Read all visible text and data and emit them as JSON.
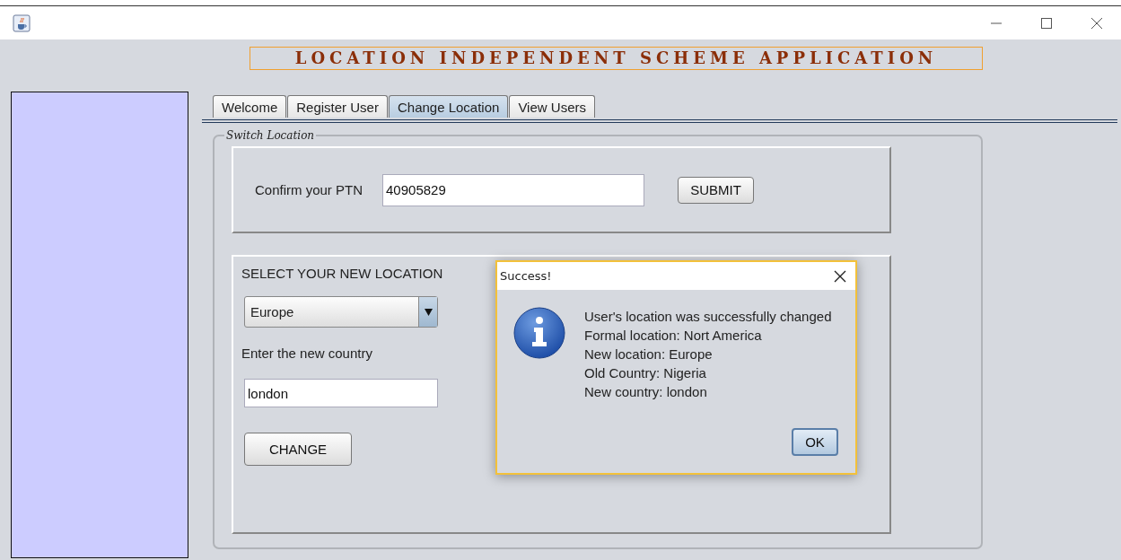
{
  "app_banner": "LOCATION INDEPENDENT SCHEME APPLICATION",
  "tabs": [
    {
      "label": "Welcome",
      "selected": false
    },
    {
      "label": "Register User",
      "selected": false
    },
    {
      "label": "Change Location",
      "selected": true
    },
    {
      "label": "View Users",
      "selected": false
    }
  ],
  "group_title": "Switch Location",
  "ptn_panel": {
    "label": "Confirm your PTN",
    "value": "40905829",
    "button": "SUBMIT"
  },
  "location_panel": {
    "heading": "SELECT YOUR NEW LOCATION",
    "region_value": "Europe",
    "country_label": "Enter the new country",
    "country_value": "london",
    "button": "CHANGE"
  },
  "dialog": {
    "title": "Success!",
    "lines": [
      "User's location was successfully changed",
      "Formal location: Nort America",
      "New location: Europe",
      "Old Country: Nigeria",
      "New country: london"
    ],
    "button": "OK"
  }
}
